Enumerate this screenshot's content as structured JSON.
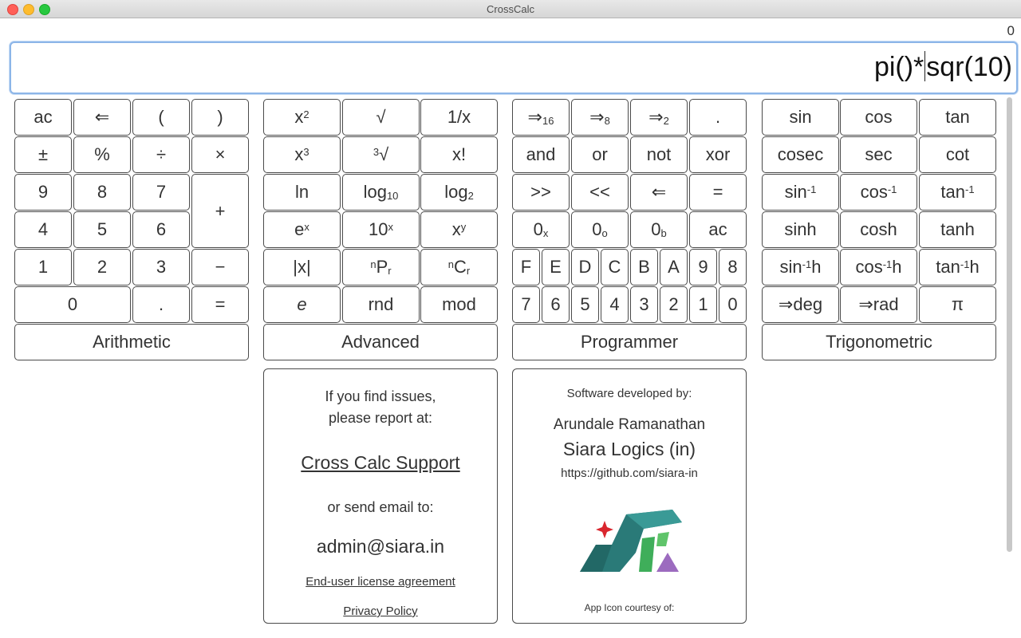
{
  "window": {
    "title": "CrossCalc"
  },
  "display": {
    "result": "0",
    "expr_before_caret": "pi()*",
    "expr_after_caret": "sqr(10)"
  },
  "arithmetic": {
    "ac": "ac",
    "backspace": "⇐",
    "lparen": "(",
    "rparen": ")",
    "plusminus": "±",
    "percent": "%",
    "divide": "÷",
    "multiply": "×",
    "n9": "9",
    "n8": "8",
    "n7": "7",
    "plus": "+",
    "n4": "4",
    "n5": "5",
    "n6": "6",
    "n1": "1",
    "n2": "2",
    "n3": "3",
    "minus": "−",
    "n0": "0",
    "dot": ".",
    "equals": "="
  },
  "advanced": {
    "sq_base": "x",
    "sq_sup": "2",
    "sqrt": "√",
    "reciprocal": "1/x",
    "cube_base": "x",
    "cube_sup": "3",
    "cbrt_sup": "3",
    "cbrt_sign": "√",
    "factorial": "x!",
    "ln": "ln",
    "log10_base": "log",
    "log10_sub": "10",
    "log2_base": "log",
    "log2_sub": "2",
    "exp_base": "e",
    "exp_sup": "x",
    "pow10_base": "10",
    "pow10_sup": "x",
    "pow_base": "x",
    "pow_sup": "y",
    "abs": "|x|",
    "npr_sup": "n",
    "npr_base": "P",
    "npr_sub": "r",
    "ncr_sup": "n",
    "ncr_base": "C",
    "ncr_sub": "r",
    "e": "e",
    "rnd": "rnd",
    "mod": "mod"
  },
  "programmer": {
    "to16": "⇒",
    "to16_sub": "16",
    "to8": "⇒",
    "to8_sub": "8",
    "to2": "⇒",
    "to2_sub": "2",
    "dot": ".",
    "and": "and",
    "or": "or",
    "not": "not",
    "xor": "xor",
    "shr": ">>",
    "shl": "<<",
    "back": "⇐",
    "eq": "=",
    "hex": "0",
    "hex_sub": "x",
    "oct": "0",
    "oct_sub": "o",
    "bin": "0",
    "bin_sub": "b",
    "ac": "ac",
    "digits_row1": [
      "F",
      "E",
      "D",
      "C",
      "B",
      "A",
      "9",
      "8"
    ],
    "digits_row2": [
      "7",
      "6",
      "5",
      "4",
      "3",
      "2",
      "1",
      "0"
    ]
  },
  "trig": {
    "sin": "sin",
    "cos": "cos",
    "tan": "tan",
    "cosec": "cosec",
    "sec": "sec",
    "cot": "cot",
    "asin_base": "sin",
    "acos_base": "cos",
    "atan_base": "tan",
    "inv_sup": "-1",
    "sinh": "sinh",
    "cosh": "cosh",
    "tanh": "tanh",
    "h": "h",
    "todeg": "⇒deg",
    "torad": "⇒rad",
    "pi": "π"
  },
  "categories": {
    "arithmetic": "Arithmetic",
    "advanced": "Advanced",
    "programmer": "Programmer",
    "trigonometric": "Trigonometric"
  },
  "support": {
    "line1": "If you find issues,",
    "line2": "please report at:",
    "link": "Cross Calc Support",
    "line3": "or send email to:",
    "email": "admin@siara.in",
    "eula": "End-user license agreement",
    "privacy": "Privacy Policy"
  },
  "about": {
    "line1": "Software developed by:",
    "name": "Arundale Ramanathan",
    "company": "Siara Logics (in)",
    "url": "https://github.com/siara-in",
    "icon_credit": "App Icon courtesy of:"
  }
}
